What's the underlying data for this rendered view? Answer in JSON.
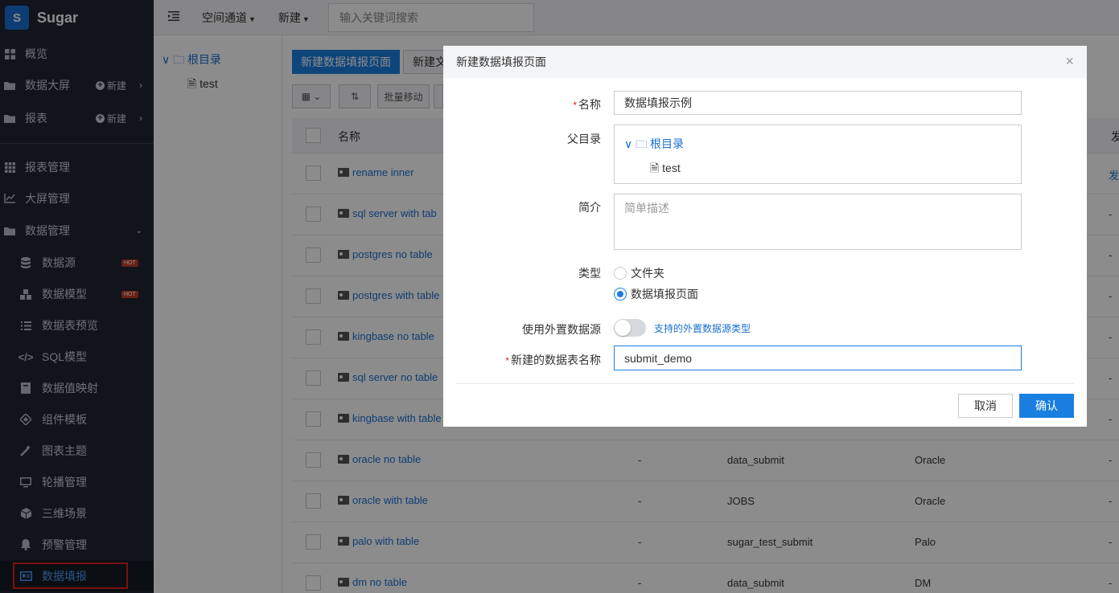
{
  "app": {
    "logo_letter": "S",
    "name": "Sugar"
  },
  "sidebar": {
    "items": [
      {
        "label": "概览",
        "icon": "grid-icon"
      },
      {
        "label": "数据大屏",
        "icon": "folder-icon",
        "new_label": "新建"
      },
      {
        "label": "报表",
        "icon": "folder-icon",
        "new_label": "新建"
      },
      {
        "label": "报表管理",
        "icon": "apps-icon"
      },
      {
        "label": "大屏管理",
        "icon": "line-chart-icon"
      },
      {
        "label": "数据管理",
        "icon": "folder-icon"
      },
      {
        "label": "数据源",
        "icon": "database-icon",
        "badge": "HOT"
      },
      {
        "label": "数据模型",
        "icon": "cubes-icon",
        "badge": "HOT"
      },
      {
        "label": "数据表预览",
        "icon": "list-icon"
      },
      {
        "label": "SQL模型",
        "icon": "code-icon"
      },
      {
        "label": "数据值映射",
        "icon": "book-icon"
      },
      {
        "label": "组件模板",
        "icon": "component-icon"
      },
      {
        "label": "图表主题",
        "icon": "magic-wand-icon"
      },
      {
        "label": "轮播管理",
        "icon": "monitor-icon"
      },
      {
        "label": "三维场景",
        "icon": "cube-icon"
      },
      {
        "label": "预警管理",
        "icon": "bell-icon"
      },
      {
        "label": "数据填报",
        "icon": "id-card-icon"
      }
    ]
  },
  "topbar": {
    "space": "空间通道",
    "new": "新建",
    "search_placeholder": "输入关键词搜索"
  },
  "tree": {
    "root": "根目录",
    "child": "test"
  },
  "main": {
    "new_page_button": "新建数据填报页面",
    "new_folder_button": "新建文",
    "batch_move": "批量移动",
    "column_name": "名称",
    "column_partial": "发",
    "rows": [
      {
        "name": "rename inner",
        "c1": "",
        "c2": "",
        "c3": "",
        "c4": "发"
      },
      {
        "name": "sql server with tab",
        "c4": "-"
      },
      {
        "name": "postgres no table",
        "c4": "-"
      },
      {
        "name": "postgres with table",
        "c4": "-"
      },
      {
        "name": "kingbase no table",
        "c4": "-"
      },
      {
        "name": "sql server no table",
        "c4": "-"
      },
      {
        "name": "kingbase with table",
        "c4": "-"
      },
      {
        "name": "oracle no table",
        "c1": "-",
        "c2": "data_submit",
        "c3": "Oracle",
        "c4": "-"
      },
      {
        "name": "oracle with table",
        "c1": "-",
        "c2": "JOBS",
        "c3": "Oracle",
        "c4": "-"
      },
      {
        "name": "palo with table",
        "c1": "-",
        "c2": "sugar_test_submit",
        "c3": "Palo",
        "c4": "-"
      },
      {
        "name": "dm no table",
        "c1": "-",
        "c2": "data_submit",
        "c3": "DM",
        "c4": "-"
      }
    ]
  },
  "modal": {
    "title": "新建数据填报页面",
    "close": "×",
    "required_mark": "*",
    "name_label": "名称",
    "name_value": "数据填报示例",
    "parent_label": "父目录",
    "parent_root": "根目录",
    "parent_child": "test",
    "intro_label": "简介",
    "intro_placeholder": "简单描述",
    "type_label": "类型",
    "type_folder": "文件夹",
    "type_page": "数据填报页面",
    "external_label": "使用外置数据源",
    "external_link": "支持的外置数据源类型",
    "table_label": "新建的数据表名称",
    "table_value": "submit_demo",
    "cancel": "取消",
    "ok": "确认"
  }
}
